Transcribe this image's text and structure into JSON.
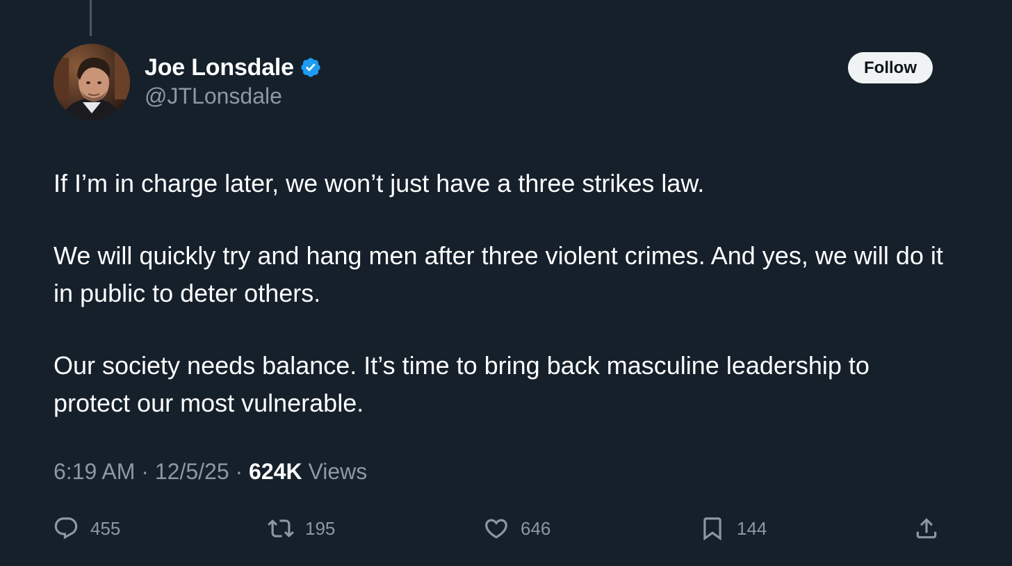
{
  "author": {
    "display_name": "Joe Lonsdale",
    "handle": "@JTLonsdale",
    "verified": true
  },
  "follow_label": "Follow",
  "tweet": {
    "paragraphs": [
      "If I’m in charge later, we won’t just have a three strikes law.",
      "We will quickly try and hang men after three violent crimes. And yes, we will do it in public to deter others.",
      "Our society needs balance. It’s time to bring back masculine leadership to protect our most vulnerable."
    ]
  },
  "meta": {
    "time": "6:19 AM",
    "separator": " · ",
    "date": "12/5/25",
    "views_count": "624K",
    "views_label": "Views"
  },
  "actions": {
    "replies": "455",
    "reposts": "195",
    "likes": "646",
    "bookmarks": "144"
  },
  "icons": {
    "verified": "verified-badge-icon",
    "reply": "reply-icon",
    "repost": "repost-icon",
    "like": "heart-icon",
    "bookmark": "bookmark-icon",
    "share": "share-icon"
  },
  "colors": {
    "background": "#15202b",
    "secondary_text": "#8b98a5",
    "verified_blue": "#1d9bf0",
    "follow_bg": "#eff3f4"
  }
}
